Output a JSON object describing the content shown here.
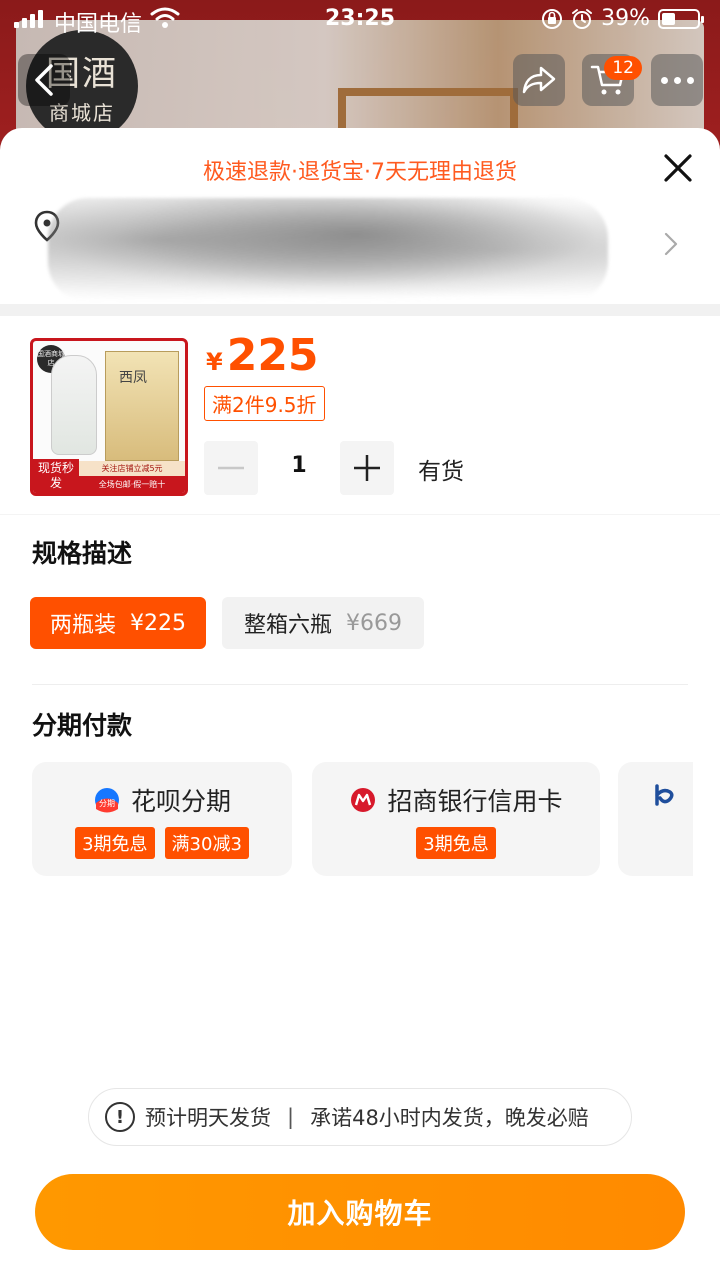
{
  "status_bar": {
    "carrier": "中国电信",
    "time": "23:25",
    "battery": "39%",
    "battery_level": 0.39
  },
  "background": {
    "store_logo_line1": "国酒",
    "store_logo_line2": "商城店",
    "cart_count": "12",
    "icons": [
      "back-icon",
      "share-icon",
      "cart-icon",
      "more-icon"
    ]
  },
  "sheet": {
    "promise": "极速退款·退货宝·7天无理由退货",
    "address": {
      "icon": "location-pin-icon",
      "text": ""
    },
    "product": {
      "thumb": {
        "logo": "国酒商城店",
        "box_title": "西凤",
        "tag": "现货秒发",
        "strip1": "关注店铺立减5元",
        "strip2": "全场包邮·假一赔十"
      },
      "currency": "¥",
      "price": "225",
      "discount": "满2件9.5折",
      "quantity": "1",
      "stock": "有货"
    },
    "spec_section": {
      "title": "规格描述",
      "options": [
        {
          "name": "两瓶装",
          "price": "¥225",
          "selected": true
        },
        {
          "name": "整箱六瓶",
          "price": "¥669",
          "selected": false
        }
      ]
    },
    "installment_section": {
      "title": "分期付款",
      "options": [
        {
          "name": "花呗分期",
          "icon": "huabei-icon",
          "badges": [
            "3期免息",
            "满30减3"
          ]
        },
        {
          "name": "招商银行信用卡",
          "icon": "cmb-icon",
          "badges": [
            "3期免息"
          ]
        },
        {
          "name": "",
          "icon": "bank-icon",
          "badges": []
        }
      ]
    },
    "notice": {
      "icon": "info-icon",
      "left": "预计明天发货",
      "separator": "|",
      "right": "承诺48小时内发货，晚发必赔"
    },
    "add_to_cart": "加入购物车"
  },
  "colors": {
    "accent": "#ff5000",
    "cta": "#ff8a00",
    "promise_text": "#ff5a1f"
  }
}
